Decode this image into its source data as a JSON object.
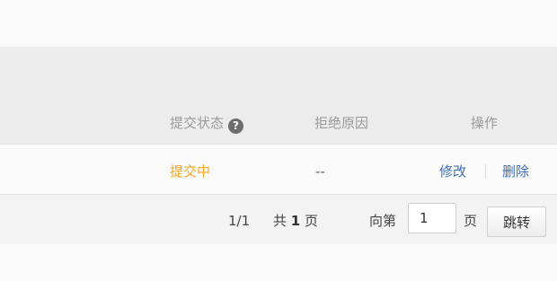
{
  "table": {
    "columns": {
      "status": "提交状态",
      "reject_reason": "拒绝原因",
      "actions": "操作"
    },
    "help_icon_glyph": "?",
    "rows": [
      {
        "status": "提交中",
        "reject_reason": "--",
        "edit_label": "修改",
        "delete_label": "删除"
      }
    ]
  },
  "pagination": {
    "page_indicator": "1/1",
    "total_prefix": "共",
    "total_pages": "1",
    "total_suffix": "页",
    "goto_prefix": "向第",
    "goto_value": "1",
    "goto_suffix": "页",
    "jump_label": "跳转"
  },
  "colors": {
    "status_pending": "#f5a623",
    "link": "#3c6fb5",
    "header_bg": "#ececec"
  }
}
